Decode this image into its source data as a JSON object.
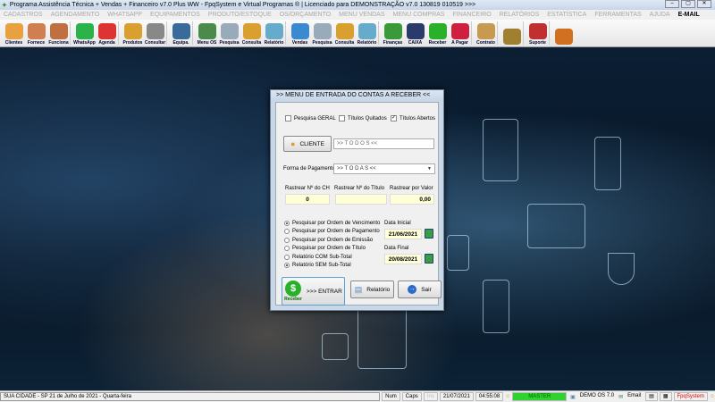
{
  "window": {
    "title": "Programa Assistência Técnica + Vendas + Financeiro v7.0 Plus WW - FpqSystem e Virtual Programas ® | Licenciado para  DEMONSTRAÇÃO v7.0 130819 010519 >>>",
    "min": "–",
    "max": "▢",
    "close": "✕"
  },
  "menu": [
    "CADASTROS",
    "AGENDAMENTO",
    "WHATSAPP",
    "EQUIPAMENTOS",
    "PRODUTO/ESTOQUE",
    "OS/ORÇAMENTO",
    "MENU VENDAS",
    "MENU COMPRAS",
    "FINANCEIRO",
    "RELATÓRIOS",
    "ESTATÍSTICA",
    "FERRAMENTAS",
    "AJUDA",
    "E-MAIL"
  ],
  "toolbar": [
    {
      "label": "Clientes",
      "color": "#e8a040"
    },
    {
      "label": "Fornece",
      "color": "#d08050"
    },
    {
      "label": "Funciona",
      "color": "#c07040"
    },
    {
      "sep": true
    },
    {
      "label": "WhatsApp",
      "color": "#2bb34a"
    },
    {
      "label": "Agenda",
      "color": "#d33"
    },
    {
      "sep": true
    },
    {
      "label": "Produtos",
      "color": "#d9a030"
    },
    {
      "label": "Consultar",
      "color": "#888"
    },
    {
      "sep": true
    },
    {
      "label": "Equipa.",
      "color": "#3a6a9a"
    },
    {
      "sep": true
    },
    {
      "label": "Menu OS",
      "color": "#4a8a4a"
    },
    {
      "label": "Pesquisa",
      "color": "#9ab"
    },
    {
      "label": "Consulta",
      "color": "#d9a030"
    },
    {
      "label": "Relatório",
      "color": "#6ac"
    },
    {
      "sep": true
    },
    {
      "label": "Vendas",
      "color": "#3a8ad0"
    },
    {
      "label": "Pesquisa",
      "color": "#9ab"
    },
    {
      "label": "Consulta",
      "color": "#d9a030"
    },
    {
      "label": "Relatório",
      "color": "#6ac"
    },
    {
      "sep": true
    },
    {
      "label": "Finanças",
      "color": "#3a9a3a"
    },
    {
      "label": "CAIXA",
      "color": "#2a3a6a"
    },
    {
      "label": "Receber",
      "color": "#2ab02a"
    },
    {
      "label": "A Pagar",
      "color": "#d02040"
    },
    {
      "sep": true
    },
    {
      "label": "Contrato",
      "color": "#c89a50"
    },
    {
      "sep": true
    },
    {
      "label": "",
      "color": "#a08030"
    },
    {
      "sep": true
    },
    {
      "label": "Suporte",
      "color": "#c03030"
    },
    {
      "sep": true
    },
    {
      "label": "",
      "color": "#d07020"
    }
  ],
  "dialog": {
    "title": ">>  MENU DE ENTRADA DO CONTAS A RECEBER  <<",
    "checks": [
      {
        "label": "Pesquisa GERAL",
        "checked": false
      },
      {
        "label": "Títulos Quitados",
        "checked": false
      },
      {
        "label": "Títulos Abertos",
        "checked": true
      }
    ],
    "cliente_button": "CLIENTE",
    "cliente_value": ">> T O D O S <<",
    "forma_label": "Forma de Pagamento",
    "forma_value": ">> T O D A S <<",
    "rastrear": [
      {
        "label": "Rastrear Nº do CH",
        "value": "0"
      },
      {
        "label": "Rastrear Nº do Título",
        "value": ""
      },
      {
        "label": "Rastrear por Valor",
        "value": "0,00"
      }
    ],
    "radios": [
      {
        "label": "Pesquisar por Ordem de Vencimento",
        "on": true
      },
      {
        "label": "Pesquisar por Ordem de Pagamento",
        "on": false
      },
      {
        "label": "Pesquisar por Ordem de Emissão",
        "on": false
      },
      {
        "label": "Pesquisar por Ordem de Título",
        "on": false
      },
      {
        "label": "Relatório COM Sub-Total",
        "on": false
      },
      {
        "label": "Relatório SEM Sub-Total",
        "on": true
      }
    ],
    "data_inicial_label": "Data Inicial",
    "data_inicial": "21/06/2021",
    "data_final_label": "Data Final",
    "data_final": "20/08/2021",
    "enter_icon_label": "Receber",
    "enter_button": ">>> ENTRAR",
    "relatorio_button": "Relatório",
    "sair_button": "Sair"
  },
  "status": {
    "city": "SUA CIDADE - SP 21 de Julho de 2021 - Quarta-feira",
    "num": "Num",
    "caps": "Caps",
    "ins": "Ins",
    "date": "21/07/2021",
    "time": "04:55:08",
    "user": "MASTER",
    "version": "DEMO OS 7.0",
    "email": "Email",
    "brand": "FpqSystem"
  }
}
